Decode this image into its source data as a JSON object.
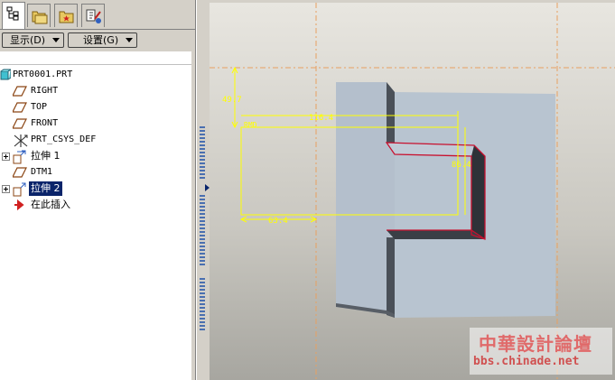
{
  "tabs": [
    {
      "icon": "model-tree-icon",
      "active": true
    },
    {
      "icon": "folder-browser-icon",
      "active": false
    },
    {
      "icon": "favorites-icon",
      "active": false
    },
    {
      "icon": "connections-icon",
      "active": false
    }
  ],
  "toolbar": {
    "show_label": "显示(D)",
    "settings_label": "设置(G)"
  },
  "tree": {
    "root": "PRT0001.PRT",
    "items": [
      {
        "label": "RIGHT",
        "icon": "datum-plane-icon"
      },
      {
        "label": "TOP",
        "icon": "datum-plane-icon"
      },
      {
        "label": "FRONT",
        "icon": "datum-plane-icon"
      },
      {
        "label": "PRT_CSYS_DEF",
        "icon": "coordinate-system-icon"
      },
      {
        "label": "拉伸 1",
        "icon": "extrude-icon"
      },
      {
        "label": "DTM1",
        "icon": "datum-plane-icon"
      },
      {
        "label": "拉伸 2",
        "icon": "extrude-icon",
        "selected": true
      },
      {
        "label": "在此插入",
        "icon": "insert-here-arrow-icon"
      }
    ]
  },
  "sketch": {
    "dimensions": [
      "49.7",
      "116.4",
      "86.4",
      "63.4"
    ],
    "ref_label": "RMD"
  },
  "colors": {
    "selection": "#0a246a",
    "dimension": "#ffff00",
    "datum_line": "#e8a060",
    "highlight_edge": "#c8102e",
    "part_face": "#b8c4d0"
  },
  "watermark": {
    "title": "中華設計論壇",
    "url": "bbs.chinade.net"
  }
}
